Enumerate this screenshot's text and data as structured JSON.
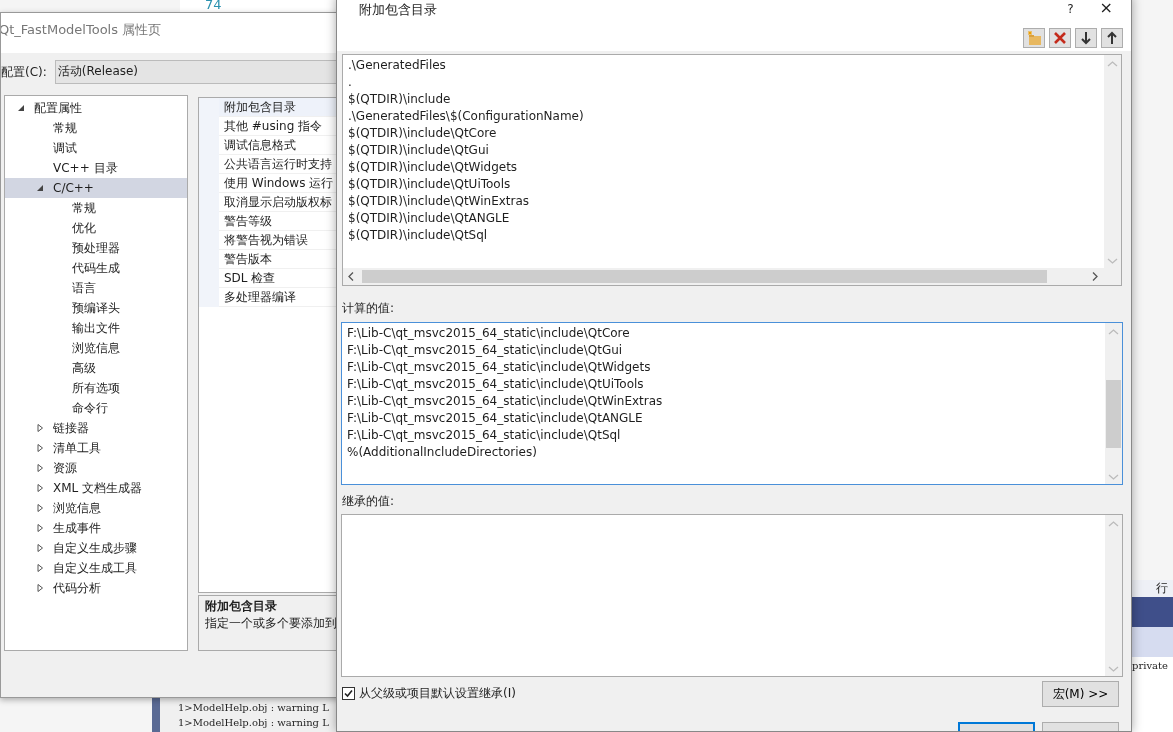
{
  "background": {
    "line_number": "74",
    "output_lines": [
      "1>ModelHelp.obj : warning L",
      "1>ModelHelp.obj : warning L"
    ],
    "editor_header": "行",
    "code_line": "private"
  },
  "property_window": {
    "title": "Qt_FastModelTools 属性页",
    "config_label": "配置(C):",
    "config_value": "活动(Release)",
    "tree": [
      {
        "label": "配置属性",
        "expanded": true,
        "selected": false,
        "children": [
          {
            "label": "常规",
            "selected": false
          },
          {
            "label": "调试",
            "selected": false
          },
          {
            "label": "VC++ 目录",
            "selected": false
          },
          {
            "label": "C/C++",
            "expanded": true,
            "selected": true,
            "children": [
              {
                "label": "常规",
                "selected": false
              },
              {
                "label": "优化",
                "selected": false
              },
              {
                "label": "预处理器",
                "selected": false
              },
              {
                "label": "代码生成",
                "selected": false
              },
              {
                "label": "语言",
                "selected": false
              },
              {
                "label": "预编译头",
                "selected": false
              },
              {
                "label": "输出文件",
                "selected": false
              },
              {
                "label": "浏览信息",
                "selected": false
              },
              {
                "label": "高级",
                "selected": false
              },
              {
                "label": "所有选项",
                "selected": false
              },
              {
                "label": "命令行",
                "selected": false
              }
            ]
          },
          {
            "label": "链接器",
            "expanded": false,
            "selected": false
          },
          {
            "label": "清单工具",
            "expanded": false,
            "selected": false
          },
          {
            "label": "资源",
            "expanded": false,
            "selected": false
          },
          {
            "label": "XML 文档生成器",
            "expanded": false,
            "selected": false
          },
          {
            "label": "浏览信息",
            "expanded": false,
            "selected": false
          },
          {
            "label": "生成事件",
            "expanded": false,
            "selected": false
          },
          {
            "label": "自定义生成步骤",
            "expanded": false,
            "selected": false
          },
          {
            "label": "自定义生成工具",
            "expanded": false,
            "selected": false
          },
          {
            "label": "代码分析",
            "expanded": false,
            "selected": false
          }
        ]
      }
    ],
    "properties": [
      {
        "name": "附加包含目录",
        "selected": true
      },
      {
        "name": "其他 #using 指令",
        "selected": false
      },
      {
        "name": "调试信息格式",
        "selected": false
      },
      {
        "name": "公共语言运行时支持",
        "selected": false
      },
      {
        "name": "使用 Windows 运行",
        "selected": false
      },
      {
        "name": "取消显示启动版权标",
        "selected": false
      },
      {
        "name": "警告等级",
        "selected": false
      },
      {
        "name": "将警告视为错误",
        "selected": false
      },
      {
        "name": "警告版本",
        "selected": false
      },
      {
        "name": "SDL 检查",
        "selected": false
      },
      {
        "name": "多处理器编译",
        "selected": false
      }
    ],
    "description": {
      "title": "附加包含目录",
      "text": "指定一个或多个要添加到"
    }
  },
  "dialog": {
    "title": "附加包含目录",
    "help": "?",
    "close": "×",
    "entries": [
      ".\\GeneratedFiles",
      ".",
      "$(QTDIR)\\include",
      ".\\GeneratedFiles\\$(ConfigurationName)",
      "$(QTDIR)\\include\\QtCore",
      "$(QTDIR)\\include\\QtGui",
      "$(QTDIR)\\include\\QtWidgets",
      "$(QTDIR)\\include\\QtUiTools",
      "$(QTDIR)\\include\\QtWinExtras",
      "$(QTDIR)\\include\\QtANGLE",
      "$(QTDIR)\\include\\QtSql"
    ],
    "computed_label": "计算的值:",
    "computed": [
      "F:\\Lib-C\\qt_msvc2015_64_static\\include\\QtCore",
      "F:\\Lib-C\\qt_msvc2015_64_static\\include\\QtGui",
      "F:\\Lib-C\\qt_msvc2015_64_static\\include\\QtWidgets",
      "F:\\Lib-C\\qt_msvc2015_64_static\\include\\QtUiTools",
      "F:\\Lib-C\\qt_msvc2015_64_static\\include\\QtWinExtras",
      "F:\\Lib-C\\qt_msvc2015_64_static\\include\\QtANGLE",
      "F:\\Lib-C\\qt_msvc2015_64_static\\include\\QtSql",
      "%(AdditionalIncludeDirectories)"
    ],
    "inherited_label": "继承的值:",
    "inherit": {
      "label": "从父级或项目默认设置继承(I)",
      "checked": true
    },
    "macros_button": "宏(M) >>"
  }
}
